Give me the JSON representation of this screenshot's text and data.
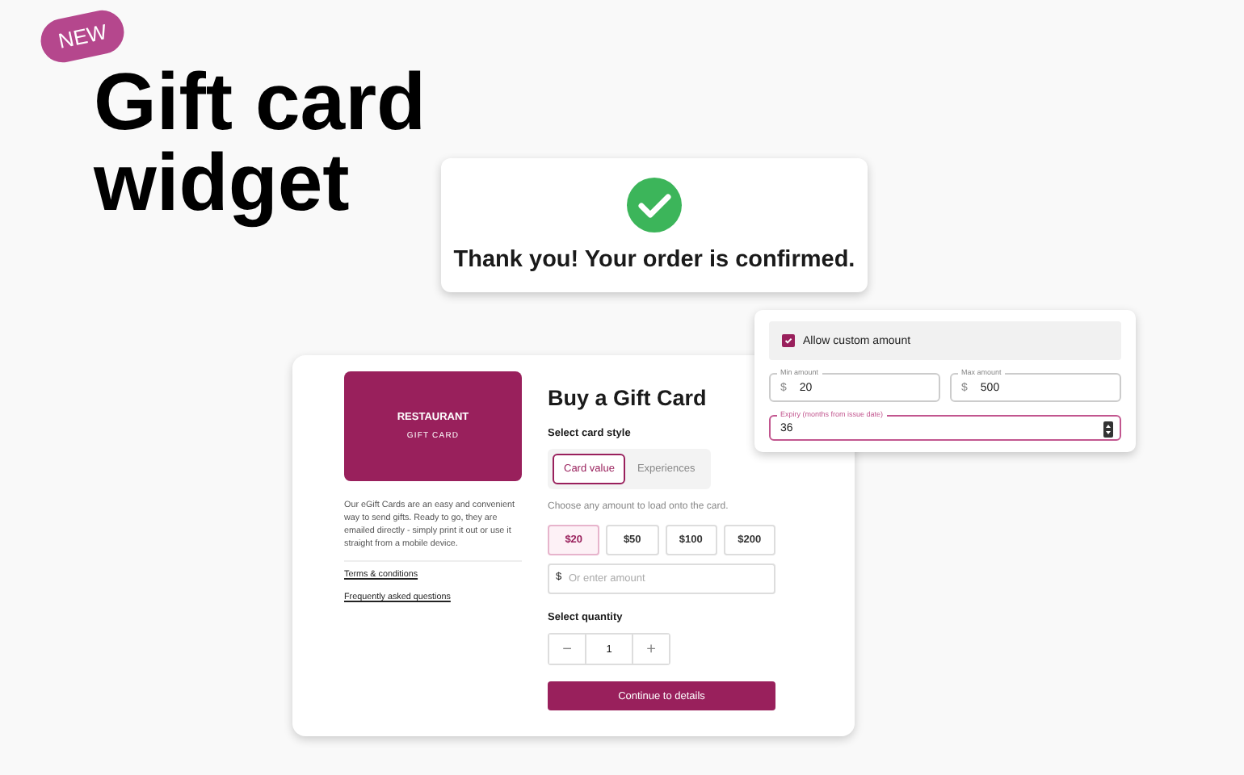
{
  "badge": "NEW",
  "headline": "Gift card widget",
  "confirmation": {
    "message": "Thank you! Your order is confirmed."
  },
  "widget": {
    "card_image": {
      "title": "RESTAURANT",
      "subtitle": "GIFT CARD"
    },
    "description": "Our eGift Cards are an easy and convenient way to send gifts. Ready to go, they are emailed directly - simply print it out or use it straight from a mobile device.",
    "links": [
      "Terms & conditions",
      "Frequently asked questions"
    ],
    "heading": "Buy a Gift Card",
    "style_label": "Select card style",
    "style_tabs": [
      {
        "label": "Card value",
        "selected": true
      },
      {
        "label": "Experiences",
        "selected": false
      }
    ],
    "amount_hint": "Choose any amount to load onto the card.",
    "amounts": [
      {
        "label": "$20",
        "selected": true
      },
      {
        "label": "$50",
        "selected": false
      },
      {
        "label": "$100",
        "selected": false
      },
      {
        "label": "$200",
        "selected": false
      }
    ],
    "custom_amount": {
      "prefix": "$",
      "placeholder": "Or enter amount"
    },
    "quantity_label": "Select quantity",
    "quantity": {
      "decrement": "−",
      "value": "1",
      "increment": "+"
    },
    "continue_button": "Continue to details"
  },
  "settings": {
    "allow_custom": {
      "label": "Allow custom amount",
      "checked": true
    },
    "min_amount": {
      "label": "Min amount",
      "prefix": "$",
      "value": "20",
      "focused": false
    },
    "max_amount": {
      "label": "Max amount",
      "prefix": "$",
      "value": "500",
      "focused": false
    },
    "expiry": {
      "label": "Expiry (months from issue date)",
      "value": "36",
      "focused": true
    }
  }
}
